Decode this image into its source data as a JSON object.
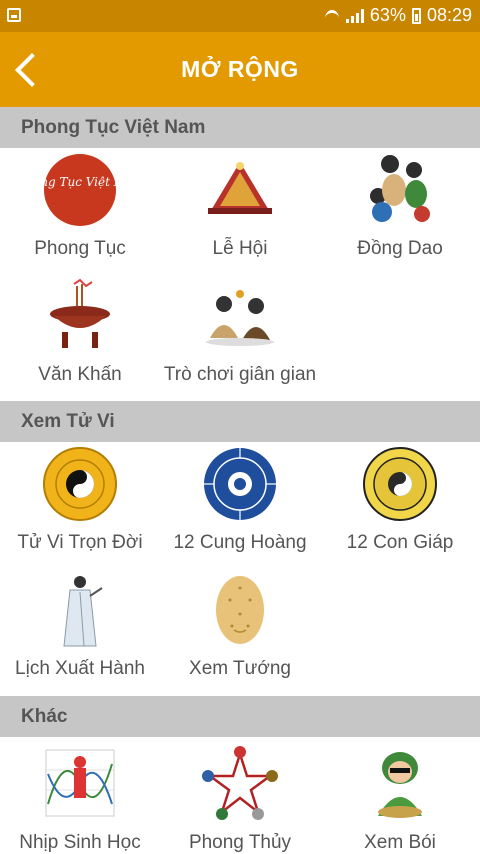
{
  "status_bar": {
    "battery": "63%",
    "time": "08:29"
  },
  "app_bar": {
    "title": "MỞ RỘNG"
  },
  "sections": [
    {
      "title": "Phong Tục Việt Nam",
      "items": [
        {
          "label": "Phong Tục",
          "icon": "phong-tuc-icon",
          "icon_text": "Phong Tục Việt Nam"
        },
        {
          "label": "Lễ Hội",
          "icon": "festival-icon"
        },
        {
          "label": "Đồng Dao",
          "icon": "children-icon"
        },
        {
          "label": "Văn Khấn",
          "icon": "incense-icon"
        },
        {
          "label": "Trò chơi giân gian",
          "icon": "folk-game-icon"
        }
      ]
    },
    {
      "title": "Xem Tử Vi",
      "items": [
        {
          "label": "Tử Vi Trọn Đời",
          "icon": "yin-yang-zodiac-icon"
        },
        {
          "label": "12 Cung Hoàng",
          "icon": "zodiac-wheel-icon"
        },
        {
          "label": "12 Con Giáp",
          "icon": "bagua-icon"
        },
        {
          "label": "Lịch Xuất Hành",
          "icon": "scholar-icon"
        },
        {
          "label": "Xem Tướng",
          "icon": "face-reading-icon"
        }
      ]
    },
    {
      "title": "Khác",
      "items": [
        {
          "label": "Nhịp Sinh Học",
          "icon": "biorhythm-icon"
        },
        {
          "label": "Phong Thủy",
          "icon": "feng-shui-icon"
        },
        {
          "label": "Xem Bói",
          "icon": "fortune-teller-icon"
        }
      ]
    }
  ],
  "colors": {
    "status_bar": "#c78500",
    "app_bar": "#e39a00",
    "section_header": "#c6c6c6",
    "label_text": "#555555"
  }
}
